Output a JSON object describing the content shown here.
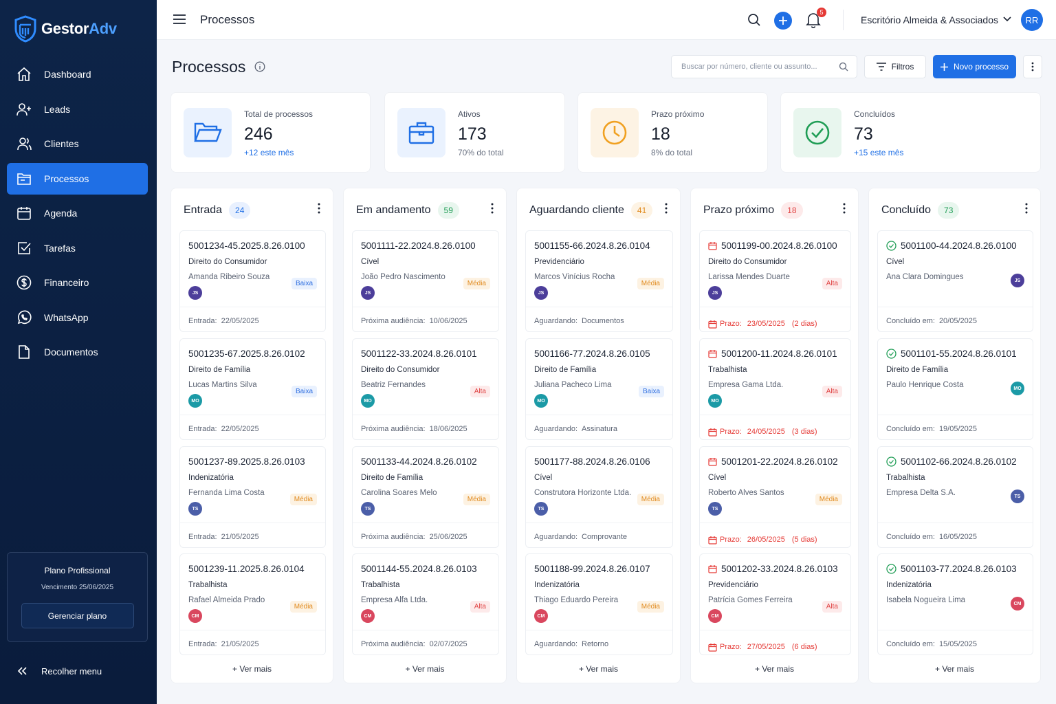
{
  "brand": {
    "name_part1": "Gestor",
    "name_part2": "Adv"
  },
  "sidebar": {
    "items": [
      {
        "label": "Dashboard",
        "icon": "home-icon"
      },
      {
        "label": "Leads",
        "icon": "user-plus-icon"
      },
      {
        "label": "Clientes",
        "icon": "users-icon"
      },
      {
        "label": "Processos",
        "icon": "folder-icon",
        "active": true
      },
      {
        "label": "Agenda",
        "icon": "calendar-icon"
      },
      {
        "label": "Tarefas",
        "icon": "checkbox-icon"
      },
      {
        "label": "Financeiro",
        "icon": "dollar-icon"
      },
      {
        "label": "WhatsApp",
        "icon": "whatsapp-icon"
      },
      {
        "label": "Documentos",
        "icon": "document-icon"
      }
    ],
    "plan": {
      "title": "Plano Profissional",
      "expiry": "Vencimento 25/06/2025",
      "button": "Gerenciar plano"
    },
    "collapse_label": "Recolher menu"
  },
  "topbar": {
    "title": "Processos",
    "notifications": "5",
    "office": "Escritório Almeida & Associados",
    "avatar": "RR"
  },
  "page": {
    "title": "Processos",
    "search_placeholder": "Buscar por número, cliente ou assunto...",
    "filter_label": "Filtros",
    "new_label": "Novo processo"
  },
  "stats": [
    {
      "label": "Total de processos",
      "value": "246",
      "sub": "+12 este mês",
      "icon": "folder-open-icon",
      "accent": "#1f6fe5"
    },
    {
      "label": "Ativos",
      "value": "173",
      "sub": "70% do total",
      "icon": "briefcase-icon",
      "accent": "#1f6fe5"
    },
    {
      "label": "Prazo próximo",
      "value": "18",
      "sub": "8% do total",
      "icon": "clock-icon",
      "accent": "#f0a020"
    },
    {
      "label": "Concluídos",
      "value": "73",
      "sub": "+15 este mês",
      "icon": "check-circle-icon",
      "accent": "#1f9d55"
    }
  ],
  "columns": [
    {
      "title": "Entrada",
      "count": "24",
      "cards": [
        {
          "number": "5001234-45.2025.8.26.0100",
          "area": "Direito do Consumidor",
          "client": "Amanda Ribeiro Souza",
          "avatar": "JS",
          "priority": "Baixa",
          "footer_label": "Entrada:",
          "footer_value": "22/05/2025"
        },
        {
          "number": "5001235-67.2025.8.26.0102",
          "area": "Direito de Família",
          "client": "Lucas Martins Silva",
          "avatar": "MO",
          "priority": "Baixa",
          "footer_label": "Entrada:",
          "footer_value": "22/05/2025"
        },
        {
          "number": "5001237-89.2025.8.26.0103",
          "area": "Indenizatória",
          "client": "Fernanda Lima Costa",
          "avatar": "TS",
          "priority": "Média",
          "footer_label": "Entrada:",
          "footer_value": "21/05/2025"
        },
        {
          "number": "5001239-11.2025.8.26.0104",
          "area": "Trabalhista",
          "client": "Rafael Almeida Prado",
          "avatar": "CM",
          "priority": "Média",
          "footer_label": "Entrada:",
          "footer_value": "21/05/2025"
        }
      ],
      "more": "+ Ver mais"
    },
    {
      "title": "Em andamento",
      "count": "59",
      "cards": [
        {
          "number": "5001111-22.2024.8.26.0100",
          "area": "Cível",
          "client": "João Pedro Nascimento",
          "avatar": "JS",
          "priority": "Média",
          "footer_label": "Próxima audiência:",
          "footer_value": "10/06/2025"
        },
        {
          "number": "5001122-33.2024.8.26.0101",
          "area": "Direito do Consumidor",
          "client": "Beatriz Fernandes",
          "avatar": "MO",
          "priority": "Alta",
          "footer_label": "Próxima audiência:",
          "footer_value": "18/06/2025"
        },
        {
          "number": "5001133-44.2024.8.26.0102",
          "area": "Direito de Família",
          "client": "Carolina Soares Melo",
          "avatar": "TS",
          "priority": "Média",
          "footer_label": "Próxima audiência:",
          "footer_value": "25/06/2025"
        },
        {
          "number": "5001144-55.2024.8.26.0103",
          "area": "Trabalhista",
          "client": "Empresa Alfa Ltda.",
          "avatar": "CM",
          "priority": "Alta",
          "footer_label": "Próxima audiência:",
          "footer_value": "02/07/2025"
        }
      ],
      "more": "+ Ver mais"
    },
    {
      "title": "Aguardando cliente",
      "count": "41",
      "cards": [
        {
          "number": "5001155-66.2024.8.26.0104",
          "area": "Previdenciário",
          "client": "Marcos Vinícius Rocha",
          "avatar": "JS",
          "priority": "Média",
          "footer_label": "Aguardando:",
          "footer_value": "Documentos"
        },
        {
          "number": "5001166-77.2024.8.26.0105",
          "area": "Direito de Família",
          "client": "Juliana Pacheco Lima",
          "avatar": "MO",
          "priority": "Baixa",
          "footer_label": "Aguardando:",
          "footer_value": "Assinatura"
        },
        {
          "number": "5001177-88.2024.8.26.0106",
          "area": "Cível",
          "client": "Construtora Horizonte Ltda.",
          "avatar": "TS",
          "priority": "Média",
          "footer_label": "Aguardando:",
          "footer_value": "Comprovante"
        },
        {
          "number": "5001188-99.2024.8.26.0107",
          "area": "Indenizatória",
          "client": "Thiago Eduardo Pereira",
          "avatar": "CM",
          "priority": "Média",
          "footer_label": "Aguardando:",
          "footer_value": "Retorno"
        }
      ],
      "more": "+ Ver mais"
    },
    {
      "title": "Prazo próximo",
      "count": "18",
      "cards": [
        {
          "number": "5001199-00.2024.8.26.0100",
          "area": "Direito do Consumidor",
          "client": "Larissa Mendes Duarte",
          "avatar": "JS",
          "priority": "Alta",
          "footer_label": "Prazo:",
          "footer_value": "23/05/2025",
          "footer_extra": "(2 dias)"
        },
        {
          "number": "5001200-11.2024.8.26.0101",
          "area": "Trabalhista",
          "client": "Empresa Gama Ltda.",
          "avatar": "MO",
          "priority": "Alta",
          "footer_label": "Prazo:",
          "footer_value": "24/05/2025",
          "footer_extra": "(3 dias)"
        },
        {
          "number": "5001201-22.2024.8.26.0102",
          "area": "Cível",
          "client": "Roberto Alves Santos",
          "avatar": "TS",
          "priority": "Média",
          "footer_label": "Prazo:",
          "footer_value": "26/05/2025",
          "footer_extra": "(5 dias)"
        },
        {
          "number": "5001202-33.2024.8.26.0103",
          "area": "Previdenciário",
          "client": "Patrícia Gomes Ferreira",
          "avatar": "CM",
          "priority": "Alta",
          "footer_label": "Prazo:",
          "footer_value": "27/05/2025",
          "footer_extra": "(6 dias)"
        }
      ],
      "more": "+ Ver mais"
    },
    {
      "title": "Concluído",
      "count": "73",
      "cards": [
        {
          "number": "5001100-44.2024.8.26.0100",
          "area": "Cível",
          "client": "Ana Clara Domingues",
          "avatar": "JS",
          "footer_label": "Concluído em:",
          "footer_value": "20/05/2025"
        },
        {
          "number": "5001101-55.2024.8.26.0101",
          "area": "Direito de Família",
          "client": "Paulo Henrique Costa",
          "avatar": "MO",
          "footer_label": "Concluído em:",
          "footer_value": "19/05/2025"
        },
        {
          "number": "5001102-66.2024.8.26.0102",
          "area": "Trabalhista",
          "client": "Empresa Delta S.A.",
          "avatar": "TS",
          "footer_label": "Concluído em:",
          "footer_value": "16/05/2025"
        },
        {
          "number": "5001103-77.2024.8.26.0103",
          "area": "Indenizatória",
          "client": "Isabela Nogueira Lima",
          "avatar": "CM",
          "footer_label": "Concluído em:",
          "footer_value": "15/05/2025"
        }
      ],
      "more": "+ Ver mais"
    }
  ]
}
